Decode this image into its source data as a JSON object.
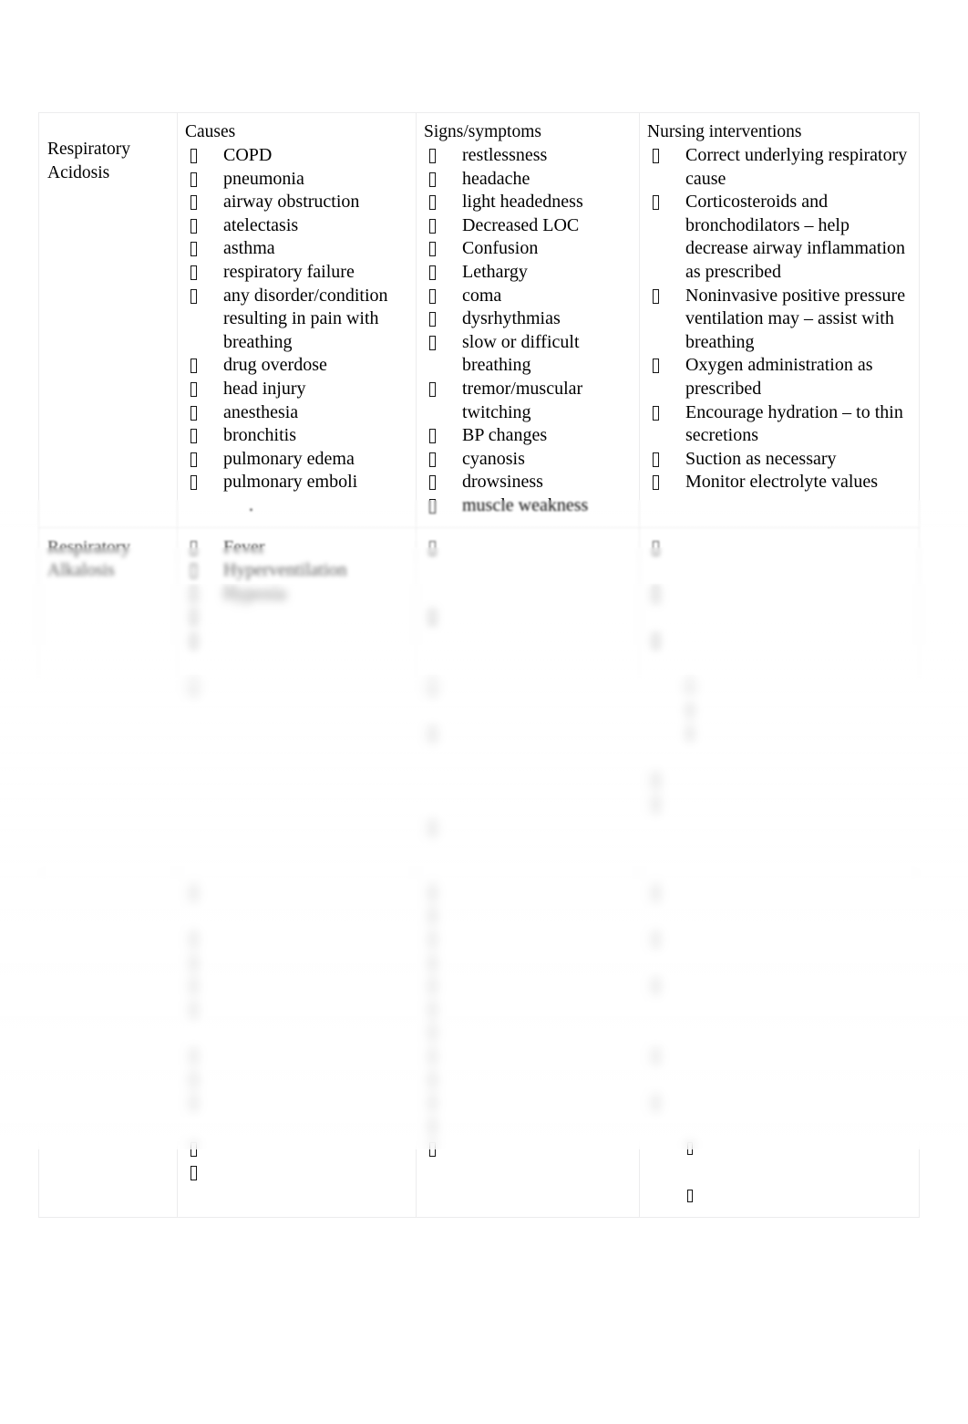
{
  "document": {
    "type": "table",
    "note_legibility": "Row 1 (Respiratory Acidosis) is fully legible. Rows 2 and 3 are progressively blurred in the source image; only their first lines are readable."
  },
  "table": {
    "headers": {
      "corner": "",
      "causes": "Causes",
      "signs": "Signs/symptoms",
      "interventions": "Nursing interventions"
    },
    "rows": [
      {
        "label": "Respiratory Acidosis",
        "label_lines": [
          "Respiratory",
          "Acidosis"
        ],
        "blurred": false,
        "causes": [
          "COPD",
          "pneumonia",
          "airway obstruction",
          "atelectasis",
          "asthma",
          " respiratory failure",
          "any disorder/condition resulting in pain with breathing",
          "drug overdose",
          "head injury",
          "anesthesia",
          "bronchitis",
          "pulmonary edema",
          "pulmonary emboli"
        ],
        "causes_trailing_text": ".",
        "signs": [
          "restlessness",
          "headache",
          " light headedness",
          "Decreased LOC",
          "Confusion",
          "Lethargy",
          "coma",
          " dysrhythmias",
          "slow or difficult breathing",
          "tremor/muscular twitching",
          " BP changes",
          "cyanosis",
          "drowsiness",
          " muscle weakness"
        ],
        "interventions": [
          "Correct underlying respiratory cause",
          "Corticosteroids and bronchodilators – help decrease airway inflammation as prescribed",
          "Noninvasive positive pressure ventilation may – assist with breathing",
          "Oxygen administration as prescribed",
          "Encourage hydration – to thin secretions",
          "Suction as necessary",
          "Monitor electrolyte values"
        ]
      },
      {
        "label": "Respiratory Alkalosis",
        "label_lines": [
          "Respiratory",
          "Alkalosis"
        ],
        "blurred": true,
        "causes": [
          "Fever",
          "Hyperventilation",
          "Hypoxia",
          "",
          "",
          "",
          ""
        ],
        "signs": [
          "",
          "",
          "",
          "",
          "",
          "",
          "",
          "",
          "",
          "",
          "",
          ""
        ],
        "interventions": [
          "",
          "",
          "",
          "",
          "",
          "",
          "",
          "",
          "",
          "",
          ""
        ]
      },
      {
        "label": "",
        "label_lines": [
          "",
          ""
        ],
        "blurred": true,
        "causes": [
          "",
          "",
          "",
          "",
          "",
          "",
          "",
          "",
          "",
          "",
          "",
          ""
        ],
        "signs": [
          "",
          "",
          "",
          "",
          "",
          "",
          "",
          "",
          "",
          "",
          "",
          ""
        ],
        "interventions": [
          "",
          "",
          "",
          "",
          "",
          "",
          "",
          "",
          "",
          "",
          "",
          ""
        ]
      }
    ]
  },
  "colors": {
    "page_background": "#ffffff",
    "text": "#000000",
    "table_border": "#ececed"
  }
}
